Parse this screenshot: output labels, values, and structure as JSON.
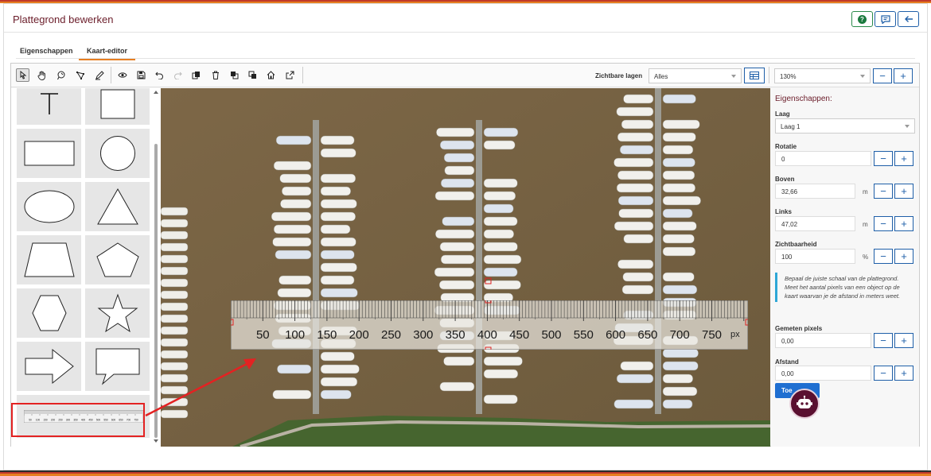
{
  "header": {
    "title": "Plattegrond bewerken"
  },
  "tabs": [
    {
      "label": "Eigenschappen",
      "active": false
    },
    {
      "label": "Kaart-editor",
      "active": true
    }
  ],
  "toolbar": {
    "tools": [
      "select-tool",
      "pan-tool",
      "lasso-tool",
      "node-edit-tool",
      "pen-tool",
      "preview",
      "save",
      "undo",
      "redo",
      "copy",
      "delete",
      "bring-front",
      "send-back",
      "home",
      "open-external"
    ],
    "visible_layers_label": "Zichtbare lagen",
    "visible_layers_value": "Alles",
    "zoom_value": "130%",
    "minus": "−",
    "plus": "+"
  },
  "palette": {
    "shapes": [
      "text",
      "square",
      "rectangle",
      "circle",
      "ellipse",
      "triangle",
      "trapezoid",
      "pentagon",
      "hexagon",
      "star",
      "arrow",
      "speech-bubble",
      "ruler"
    ]
  },
  "ruler": {
    "labels": [
      "50",
      "100",
      "150",
      "200",
      "250",
      "300",
      "350",
      "400",
      "450",
      "500",
      "550",
      "600",
      "650",
      "700",
      "750"
    ],
    "unit": "px",
    "mini_labels": [
      "50",
      "100",
      "150",
      "200",
      "250",
      "300",
      "350",
      "400",
      "450",
      "500",
      "550",
      "600",
      "650",
      "700",
      "750"
    ]
  },
  "properties": {
    "title": "Eigenschappen:",
    "layer_label": "Laag",
    "layer_value": "Laag 1",
    "rotation_label": "Rotatie",
    "rotation_value": "0",
    "top_label": "Boven",
    "top_value": "32,66",
    "top_unit": "m",
    "left_label": "Links",
    "left_value": "47,02",
    "left_unit": "m",
    "visibility_label": "Zichtbaarheid",
    "visibility_value": "100",
    "visibility_unit": "%",
    "hint": "Bepaal de juiste schaal van de plattegrond. Meet het aantal pixels van een object op de kaart waarvan je de afstand in meters weet.",
    "measured_label": "Gemeten pixels",
    "measured_value": "0,00",
    "distance_label": "Afstand",
    "distance_value": "0,00",
    "apply_button": "Toe"
  },
  "colors": {
    "accent": "#6b1d2a",
    "primary": "#1f5fa8",
    "highlight": "#e32222",
    "water": "#7a6544"
  }
}
